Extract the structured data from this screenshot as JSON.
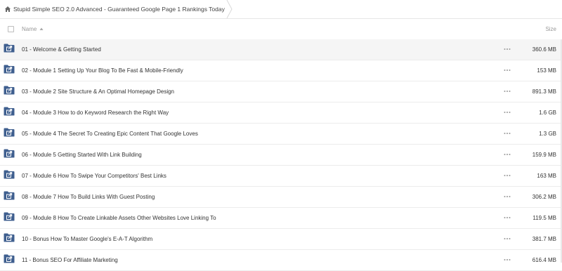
{
  "breadcrumb": {
    "label": "Stupid Simple SEO 2.0 Advanced - Guaranteed Google Page 1 Rankings Today",
    "icon": "home-icon"
  },
  "header": {
    "name_label": "Name",
    "size_label": "Size",
    "sort_icon": "sort-ascending-icon"
  },
  "folder_icon": "shared-folder-icon",
  "more_icon": "more-options-icon",
  "colors": {
    "folder": "#3f5f8f",
    "text": "#333333",
    "muted": "#999999"
  },
  "rows": [
    {
      "name": "01 - Welcome & Getting Started",
      "size": "360.6 MB"
    },
    {
      "name": "02 - Module 1 Setting Up Your Blog To Be Fast & Mobile-Friendly",
      "size": "153 MB"
    },
    {
      "name": "03 - Module 2 Site Structure & An Optimal Homepage Design",
      "size": "891.3 MB"
    },
    {
      "name": "04 - Module 3 How to do Keyword Research the Right Way",
      "size": "1.6 GB"
    },
    {
      "name": "05 - Module 4 The Secret To Creating Epic Content That Google Loves",
      "size": "1.3 GB"
    },
    {
      "name": "06 - Module 5 Getting Started With Link Building",
      "size": "159.9 MB"
    },
    {
      "name": "07 - Module 6 How To Swipe Your Competitors' Best Links",
      "size": "163 MB"
    },
    {
      "name": "08 - Module 7 How To Build Links With Guest Posting",
      "size": "306.2 MB"
    },
    {
      "name": "09 - Module 8 How To Create Linkable Assets Other Websites Love Linking To",
      "size": "119.5 MB"
    },
    {
      "name": "10 - Bonus How To Master Google's E-A-T Algorithm",
      "size": "381.7 MB"
    },
    {
      "name": "11 - Bonus SEO For Affiliate Marketing",
      "size": "616.4 MB"
    }
  ]
}
